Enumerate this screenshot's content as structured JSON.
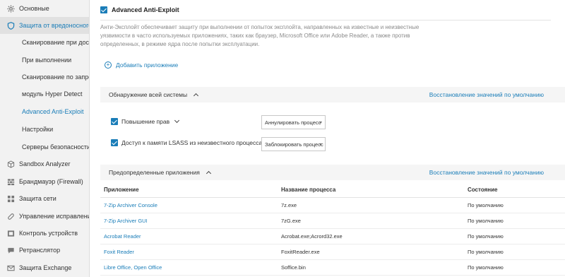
{
  "sidebar": {
    "items": [
      {
        "label": "Основные",
        "icon": "gear-icon",
        "level": "top"
      },
      {
        "label": "Защита от вредоносного",
        "icon": "shield-icon",
        "level": "top",
        "active": true
      },
      {
        "label": "Сканирование при доступе",
        "level": "sub"
      },
      {
        "label": "При выполнении",
        "level": "sub"
      },
      {
        "label": "Сканирование по запросу",
        "level": "sub"
      },
      {
        "label": "модуль Hyper Detect",
        "level": "sub"
      },
      {
        "label": "Advanced Anti-Exploit",
        "level": "sub",
        "selected": true
      },
      {
        "label": "Настройки",
        "level": "sub"
      },
      {
        "label": "Серверы безопасности",
        "level": "sub"
      },
      {
        "label": "Sandbox Analyzer",
        "icon": "cube-icon",
        "level": "top"
      },
      {
        "label": "Брандмауэр (Firewall)",
        "icon": "firewall-icon",
        "level": "top"
      },
      {
        "label": "Защита сети",
        "icon": "network-icon",
        "level": "top"
      },
      {
        "label": "Управление исправлениями",
        "icon": "patch-icon",
        "level": "top"
      },
      {
        "label": "Контроль устройств",
        "icon": "device-icon",
        "level": "top"
      },
      {
        "label": "Ретранслятор",
        "icon": "relay-icon",
        "level": "top"
      },
      {
        "label": "Защита Exchange",
        "icon": "mail-icon",
        "level": "top"
      }
    ]
  },
  "main": {
    "title": "Advanced Anti-Exploit",
    "description": "Анти-Эксплойт обеспечивает защиту при выполнении от попыток эксплойта, направленных на известные и неизвестные уязвимости в часто используемых приложениях, таких как браузер, Microsoft Office или Adobe Reader, а также против определенных, в режиме ядра после попытки эксплуатации.",
    "add_app": "Добавить приложение",
    "system_section": {
      "title": "Обнаружение всей системы",
      "restore": "Восстановление значений по умолчанию",
      "options": [
        {
          "label": "Повышение прав",
          "action": "Аннулировать процесс"
        },
        {
          "label": "Доступ к памяти LSASS из неизвестного процесса",
          "action": "Заблокировать процесс"
        }
      ]
    },
    "apps_section": {
      "title": "Предопределенные приложения",
      "restore": "Восстановление значений по умолчанию",
      "columns": [
        "Приложение",
        "Название процесса",
        "Состояние"
      ],
      "rows": [
        [
          "7-Zip Archiver Console",
          "7z.exe",
          "По умолчанию"
        ],
        [
          "7-Zip Archiver GUI",
          "7zG.exe",
          "По умолчанию"
        ],
        [
          "Acrobat Reader",
          "Acrobat.exe;Acrord32.exe",
          "По умолчанию"
        ],
        [
          "Foxit Reader",
          "FoxitReader.exe",
          "По умолчанию"
        ],
        [
          "Libre Office, Open Office",
          "Soffice.bin",
          "По умолчанию"
        ]
      ]
    }
  },
  "colors": {
    "accent": "#1a7db8",
    "sidebar_bg": "#f2f2f2",
    "section_bg": "#f5f5f5"
  }
}
